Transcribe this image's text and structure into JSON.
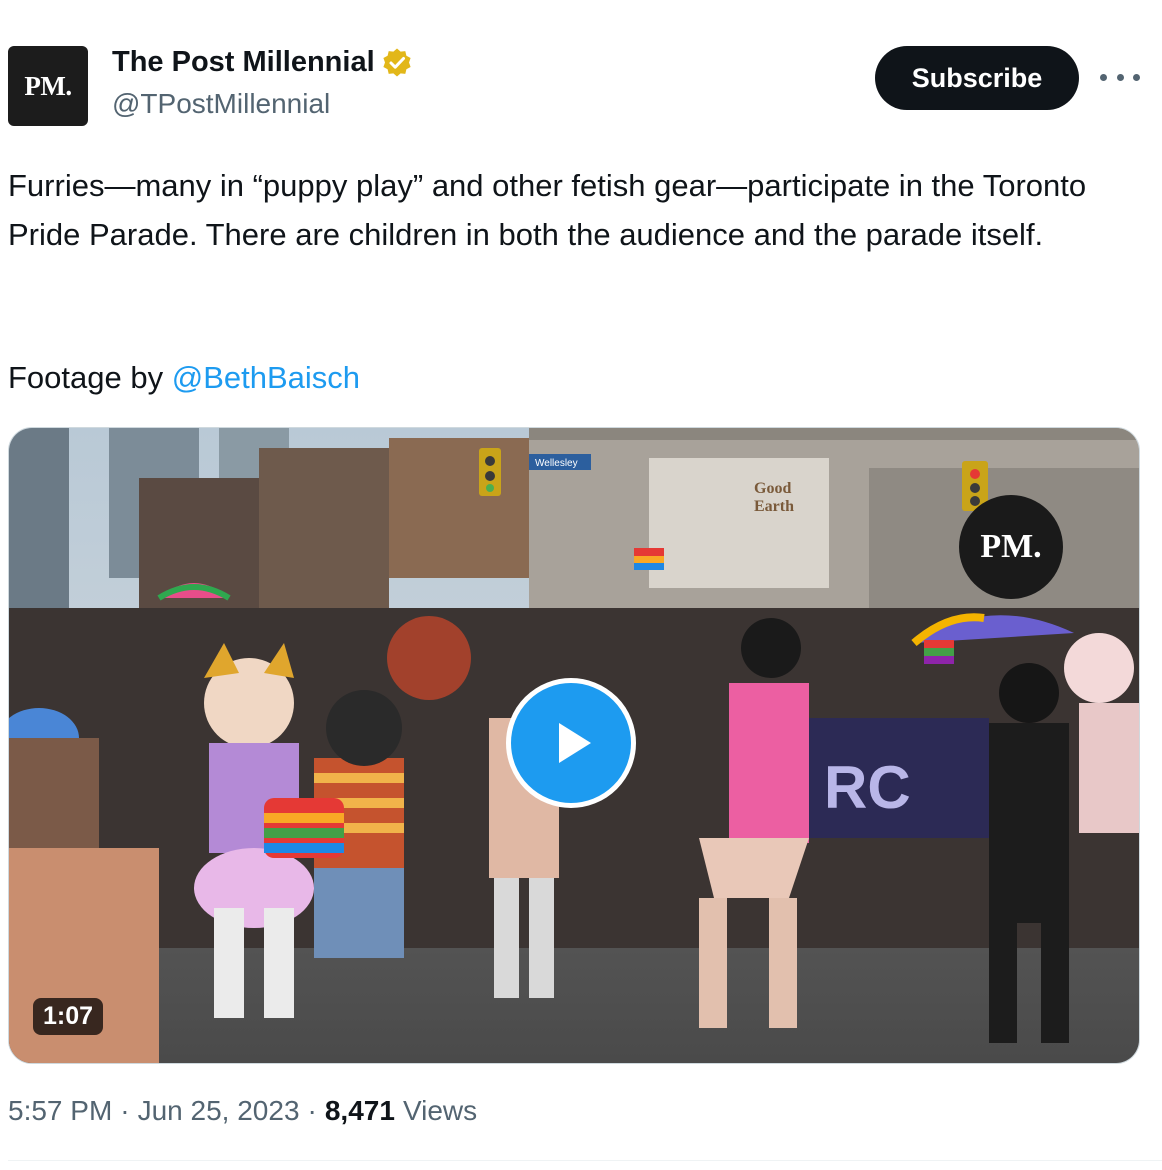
{
  "author": {
    "avatar_text": "PM.",
    "display_name": "The Post Millennial",
    "handle": "@TPostMillennial",
    "verified_badge": "gold-verified-icon"
  },
  "actions": {
    "subscribe_label": "Subscribe",
    "more_icon": "more-horizontal-icon"
  },
  "tweet": {
    "text": "Furries—many in “puppy play” and other fetish gear—participate in the Toronto Pride Parade. There are children in both the audience and the parade itself.",
    "footage_prefix": "Footage by ",
    "footage_mention": "@BethBaisch"
  },
  "media": {
    "duration": "1:07",
    "watermark": "PM.",
    "play_icon": "play-icon",
    "sign_text": "Wellesley",
    "store_text": "Good Earth"
  },
  "meta": {
    "time": "5:57 PM",
    "separator": "·",
    "date": "Jun 25, 2023",
    "views_count": "8,471",
    "views_label": "Views"
  },
  "colors": {
    "accent": "#1d9bf0",
    "text": "#0f1419",
    "secondary": "#536471",
    "verified": "#e2b719"
  }
}
